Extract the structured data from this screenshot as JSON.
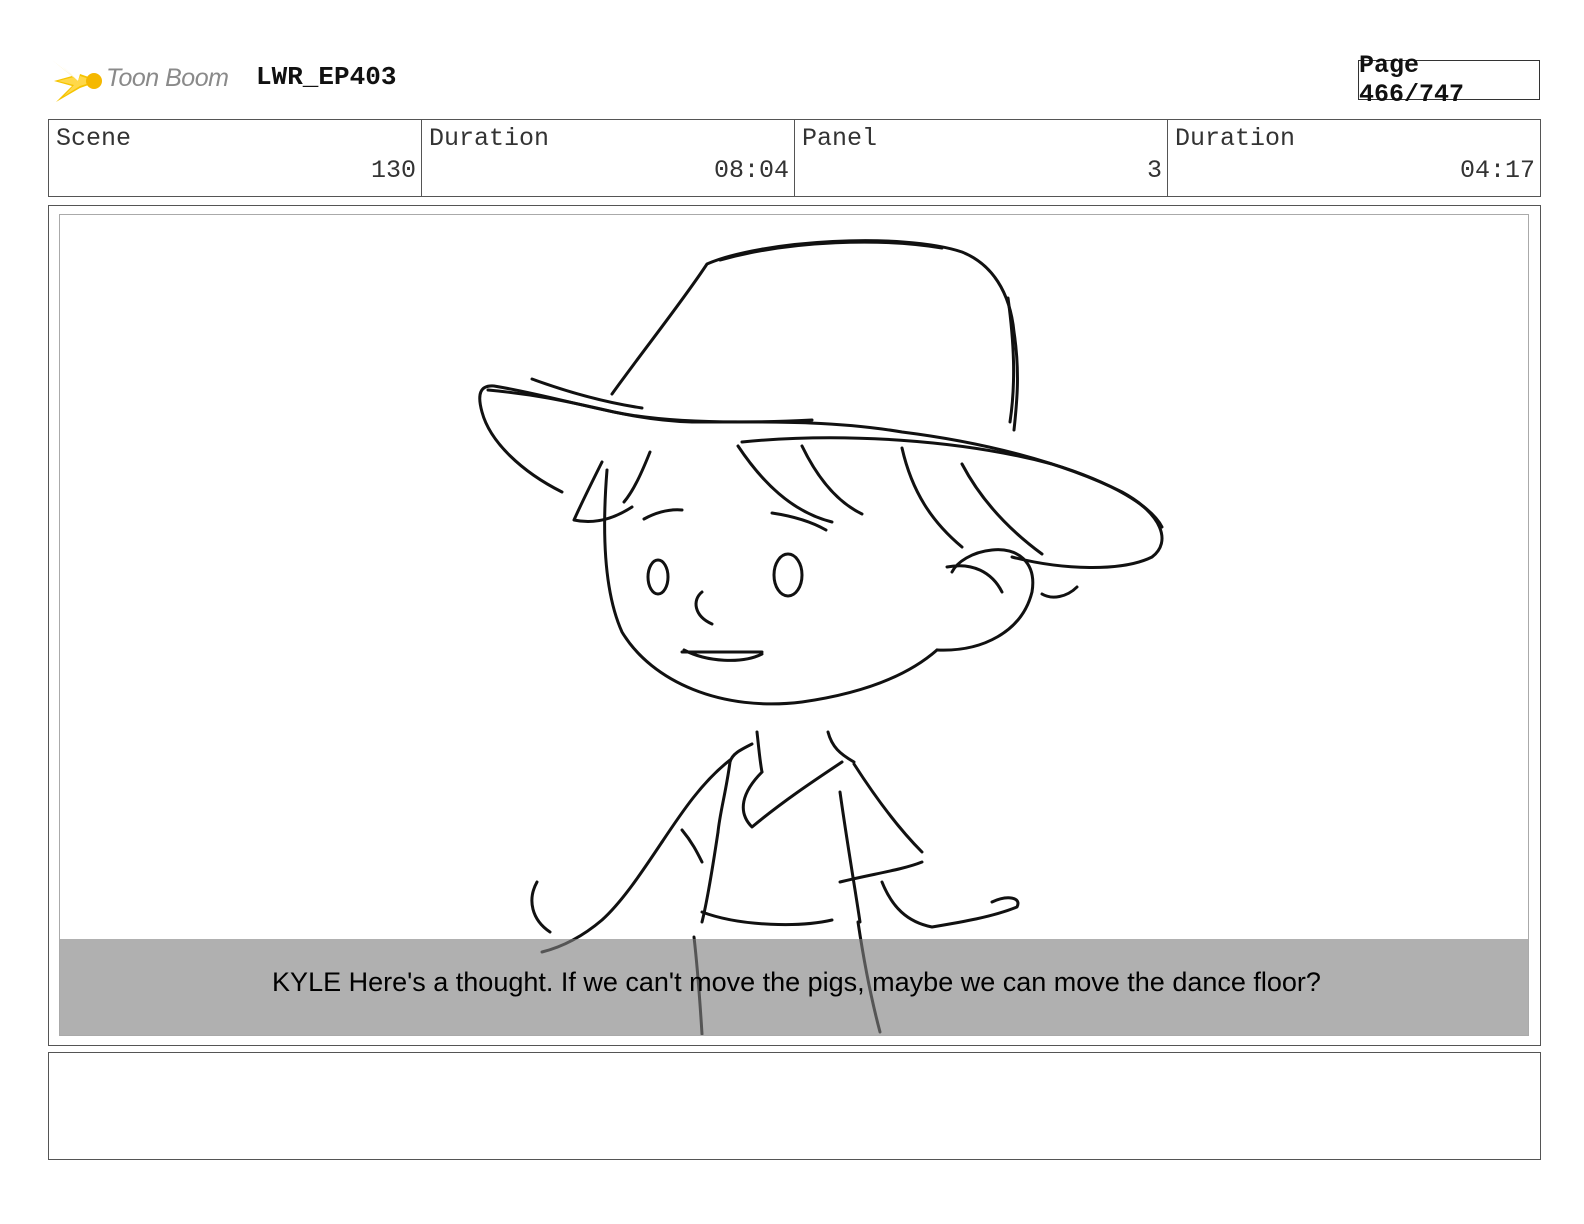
{
  "header": {
    "logo_text": "Toon Boom",
    "logo_icon": "toon-boom-star-icon",
    "episode": "LWR_EP403",
    "page": "Page 466/747"
  },
  "info": [
    {
      "label": "Scene",
      "value": "130"
    },
    {
      "label": "Duration",
      "value": "08:04"
    },
    {
      "label": "Panel",
      "value": "3"
    },
    {
      "label": "Duration",
      "value": "04:17"
    }
  ],
  "panel": {
    "caption": "KYLE Here's a thought. If we can't move the pigs, maybe we can move the dance floor?"
  },
  "notes": {
    "text": ""
  }
}
